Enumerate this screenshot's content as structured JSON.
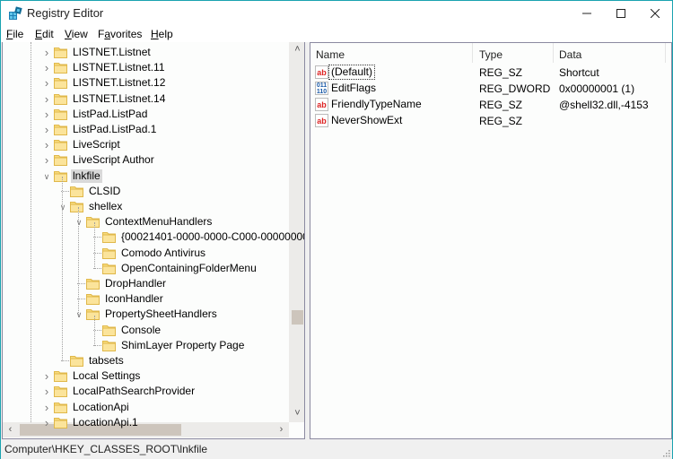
{
  "window": {
    "title": "Registry Editor",
    "icon": "registry-editor-icon",
    "controls": {
      "minimize": "minimize-icon",
      "maximize": "maximize-icon",
      "close": "close-icon"
    }
  },
  "menu": [
    {
      "label": "File",
      "accel": "F",
      "rest": "ile"
    },
    {
      "label": "Edit",
      "accel": "E",
      "rest": "dit"
    },
    {
      "label": "View",
      "accel": "V",
      "rest": "iew"
    },
    {
      "label": "Favorites",
      "pre": "F",
      "accel": "a",
      "rest": "vorites"
    },
    {
      "label": "Help",
      "accel": "H",
      "rest": "elp"
    }
  ],
  "tree": {
    "items": [
      {
        "label": "LISTNET.Listnet",
        "level": 0,
        "twisty": "collapsed"
      },
      {
        "label": "LISTNET.Listnet.11",
        "level": 0,
        "twisty": "collapsed"
      },
      {
        "label": "LISTNET.Listnet.12",
        "level": 0,
        "twisty": "collapsed"
      },
      {
        "label": "LISTNET.Listnet.14",
        "level": 0,
        "twisty": "collapsed"
      },
      {
        "label": "ListPad.ListPad",
        "level": 0,
        "twisty": "collapsed"
      },
      {
        "label": "ListPad.ListPad.1",
        "level": 0,
        "twisty": "collapsed"
      },
      {
        "label": "LiveScript",
        "level": 0,
        "twisty": "collapsed"
      },
      {
        "label": "LiveScript Author",
        "level": 0,
        "twisty": "collapsed"
      },
      {
        "label": "lnkfile",
        "level": 0,
        "twisty": "expanded",
        "selected": true
      },
      {
        "label": "CLSID",
        "level": 1,
        "twisty": "none"
      },
      {
        "label": "shellex",
        "level": 1,
        "twisty": "expanded"
      },
      {
        "label": "ContextMenuHandlers",
        "level": 2,
        "twisty": "expanded"
      },
      {
        "label": "{00021401-0000-0000-C000-00000000",
        "level": 3,
        "twisty": "none"
      },
      {
        "label": "Comodo Antivirus",
        "level": 3,
        "twisty": "none"
      },
      {
        "label": "OpenContainingFolderMenu",
        "level": 3,
        "twisty": "none"
      },
      {
        "label": "DropHandler",
        "level": 2,
        "twisty": "none"
      },
      {
        "label": "IconHandler",
        "level": 2,
        "twisty": "none"
      },
      {
        "label": "PropertySheetHandlers",
        "level": 2,
        "twisty": "expanded"
      },
      {
        "label": "Console",
        "level": 3,
        "twisty": "none"
      },
      {
        "label": "ShimLayer Property Page",
        "level": 3,
        "twisty": "none"
      },
      {
        "label": "tabsets",
        "level": 1,
        "twisty": "none"
      },
      {
        "label": "Local Settings",
        "level": 0,
        "twisty": "collapsed"
      },
      {
        "label": "LocalPathSearchProvider",
        "level": 0,
        "twisty": "collapsed"
      },
      {
        "label": "LocationApi",
        "level": 0,
        "twisty": "collapsed"
      },
      {
        "label": "LocationApi.1",
        "level": 0,
        "twisty": "collapsed"
      }
    ],
    "vscroll_position": 0.72,
    "hscroll_position": 0.0
  },
  "values": {
    "columns": [
      "Name",
      "Type",
      "Data"
    ],
    "rows": [
      {
        "icon": "string-value-icon",
        "name": "(Default)",
        "type": "REG_SZ",
        "data": "Shortcut",
        "focused": true
      },
      {
        "icon": "binary-value-icon",
        "name": "EditFlags",
        "type": "REG_DWORD",
        "data": "0x00000001 (1)"
      },
      {
        "icon": "string-value-icon",
        "name": "FriendlyTypeName",
        "type": "REG_SZ",
        "data": "@shell32.dll,-4153"
      },
      {
        "icon": "string-value-icon",
        "name": "NeverShowExt",
        "type": "REG_SZ",
        "data": ""
      }
    ]
  },
  "status": {
    "path": "Computer\\HKEY_CLASSES_ROOT\\lnkfile"
  }
}
